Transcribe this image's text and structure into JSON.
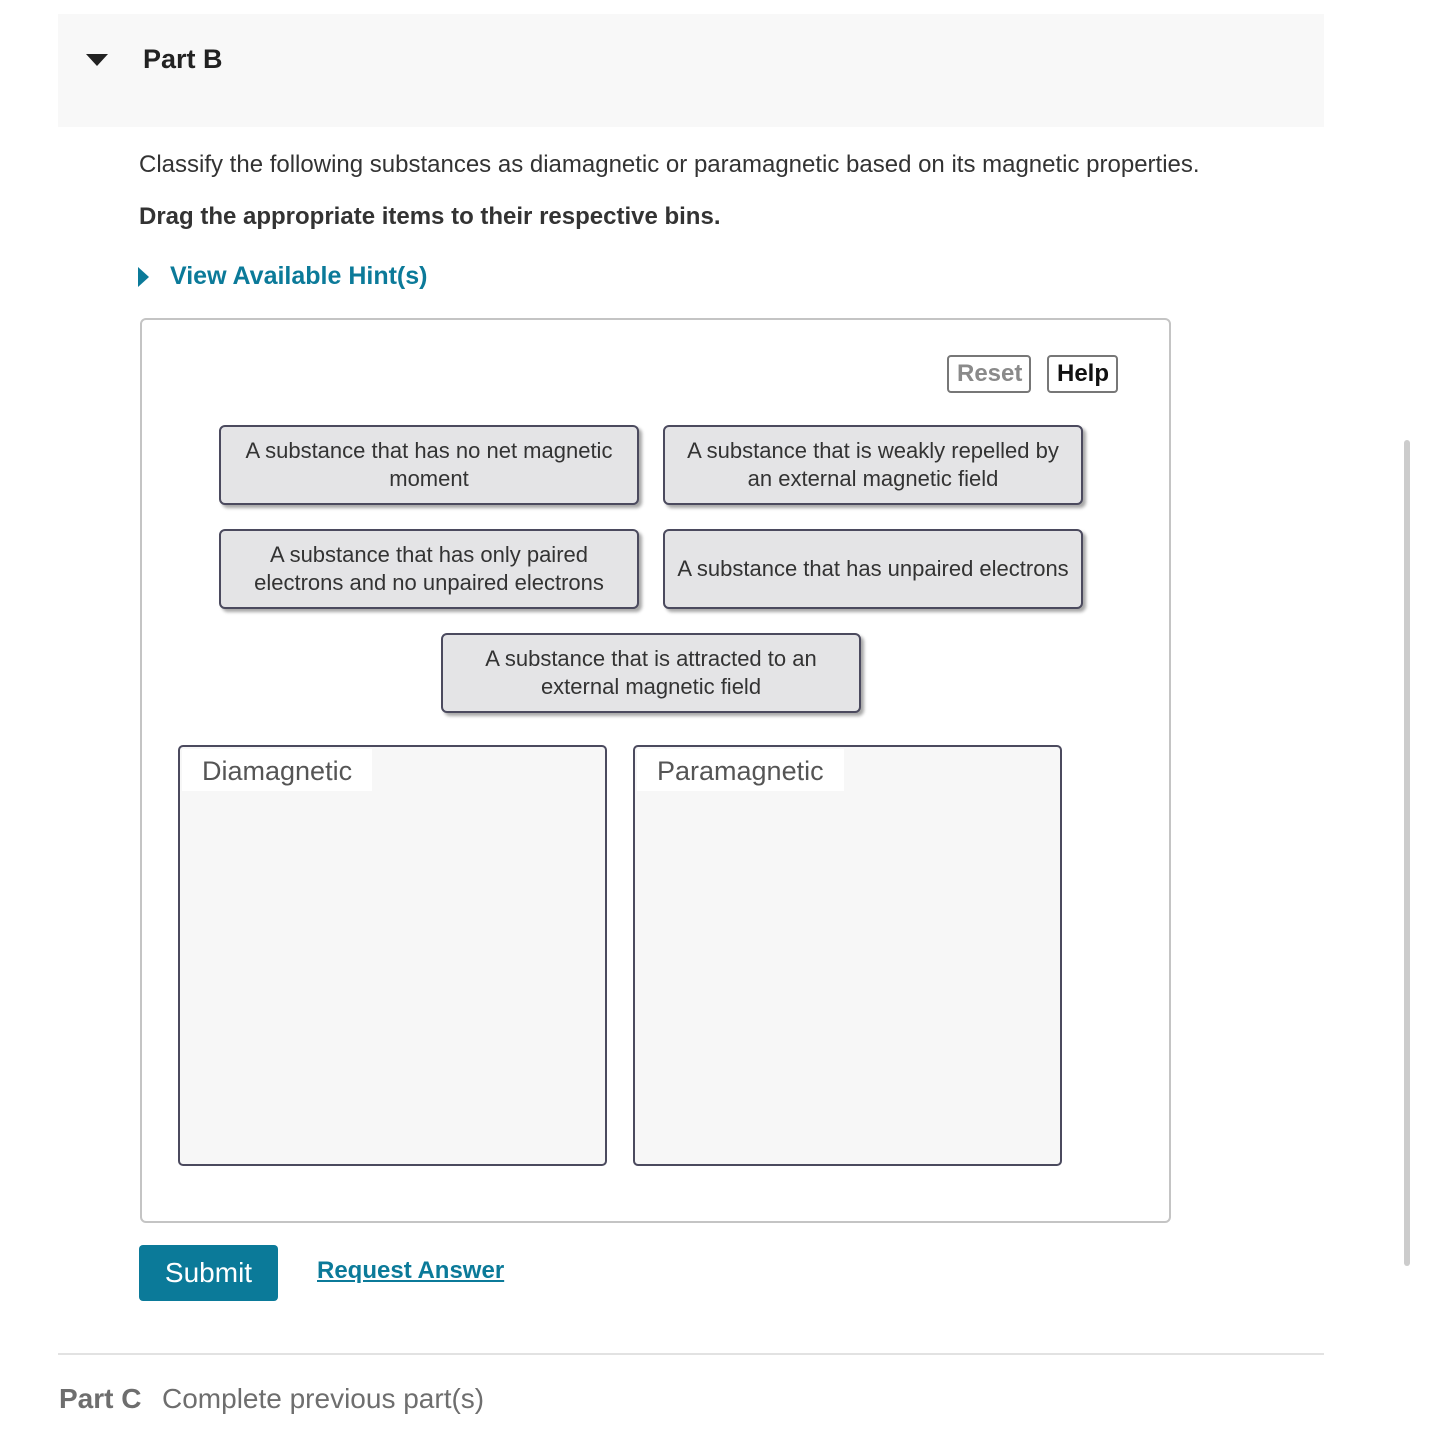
{
  "part_b": {
    "title": "Part B",
    "expand_icon": "caret-down-icon",
    "instructions": "Classify the following substances as diamagnetic or paramagnetic based on its magnetic properties.",
    "drag_instructions": "Drag the appropriate items to their respective bins.",
    "hint": {
      "icon": "caret-right-icon",
      "label": "View Available Hint(s)"
    }
  },
  "toolbar": {
    "reset_label": "Reset",
    "help_label": "Help"
  },
  "items": [
    "A substance that has no net magnetic moment",
    "A substance that is weakly repelled by an external magnetic field",
    "A substance that has only paired electrons and no unpaired electrons",
    "A substance that has unpaired electrons",
    "A substance that is attracted to an external magnetic field"
  ],
  "bins": [
    {
      "label": "Diamagnetic"
    },
    {
      "label": "Paramagnetic"
    }
  ],
  "actions": {
    "submit_label": "Submit",
    "request_answer_label": "Request Answer"
  },
  "part_c": {
    "title": "Part C",
    "status": "Complete previous part(s)"
  },
  "colors": {
    "accent": "#0b7a99",
    "item_bg": "#e4e4e6",
    "item_border": "#4b4a5e",
    "bin_bg": "#f7f7f7"
  }
}
